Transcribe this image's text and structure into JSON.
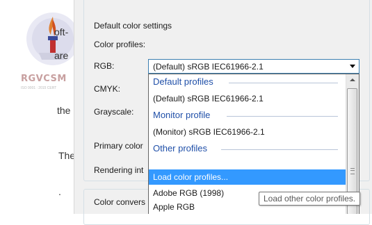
{
  "background_page": {
    "fragments": [
      "oft-",
      "are",
      "the",
      "The",
      "."
    ],
    "logo_text": "RGVCSM",
    "logo_subtext": "ISO 9001 : 2015 CERT"
  },
  "dialog": {
    "section_title": "Default color settings",
    "color_profiles_label": "Color profiles:",
    "labels": {
      "rgb": "RGB:",
      "cmyk": "CMYK:",
      "grayscale": "Grayscale:",
      "primary_color": "Primary color",
      "rendering_intent": "Rendering int"
    },
    "color_conversion_label": "Color convers",
    "rgb_combo": {
      "value": "(Default) sRGB IEC61966-2.1"
    },
    "dropdown": {
      "items": [
        {
          "text": "Default profiles",
          "kind": "header"
        },
        {
          "text": "(Default) sRGB IEC61966-2.1",
          "kind": "item"
        },
        {
          "text": "Monitor profile",
          "kind": "header"
        },
        {
          "text": "(Monitor) sRGB IEC61966-2.1",
          "kind": "item"
        },
        {
          "text": "Other profiles",
          "kind": "header"
        },
        {
          "text": "Load color profiles...",
          "kind": "item",
          "selected": true
        },
        {
          "text": "Adobe RGB (1998)",
          "kind": "item"
        },
        {
          "text": "Apple RGB",
          "kind": "item"
        }
      ]
    },
    "tooltip": "Load other color profiles."
  },
  "colors": {
    "accent": "#3399ff",
    "header_text": "#1f4fa8"
  }
}
